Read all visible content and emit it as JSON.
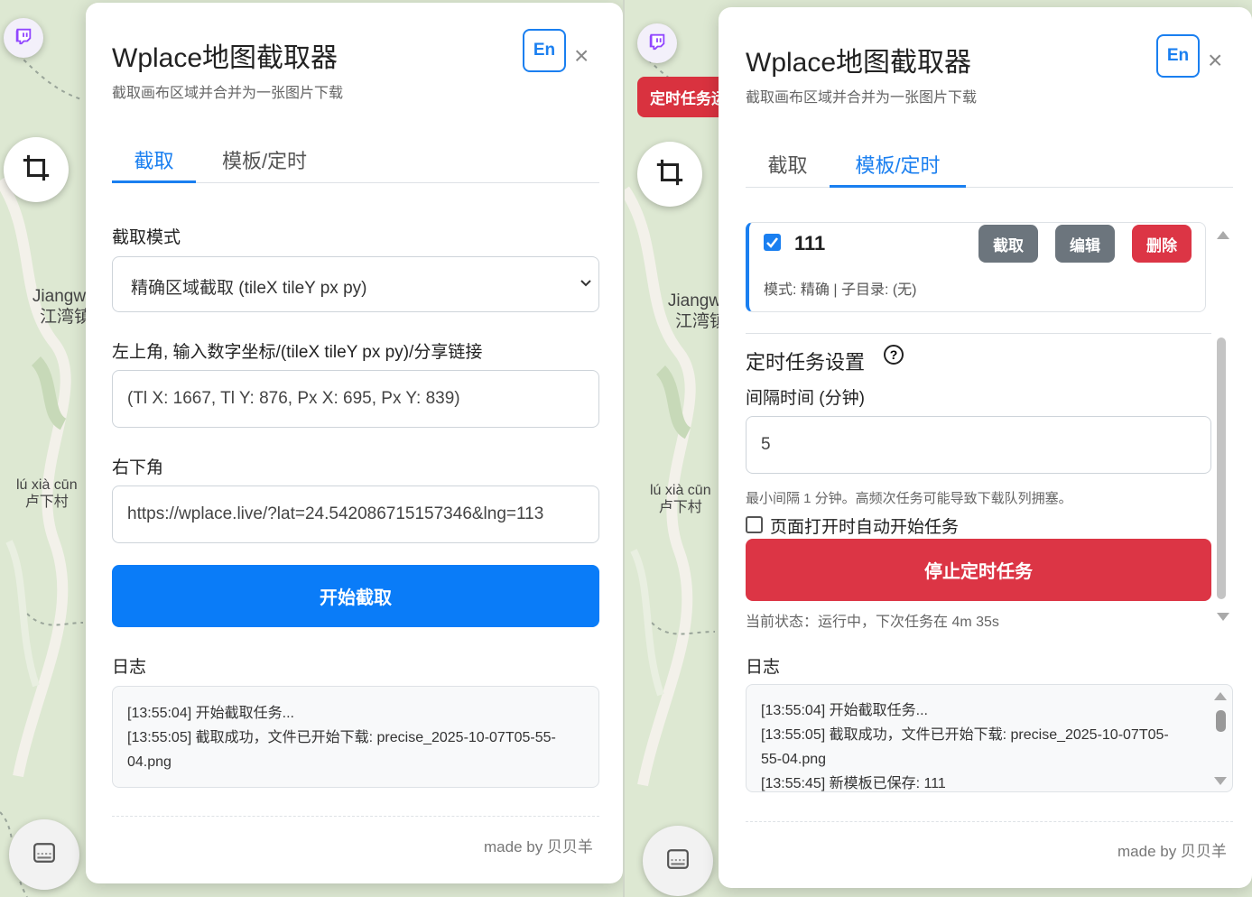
{
  "colors": {
    "accent": "#0a7cf8",
    "danger": "#dc3545",
    "secondary": "#6c757d"
  },
  "icons": {
    "twitch": "twitch-icon",
    "crop": "crop-icon",
    "gallery": "gallery-icon",
    "close": "close-icon",
    "chevron": "chevron-down-icon",
    "help": "help-circle-icon"
  },
  "map": {
    "label_jiangwan_latin": "Jiangw",
    "label_jiangwan_cn": "江湾镇",
    "label_luxia_latin": "lú xià cūn",
    "label_luxia_cn": "卢下村"
  },
  "left": {
    "panel_title": "Wplace地图截取器",
    "panel_subtitle": "截取画布区域并合并为一张图片下载",
    "lang_button": "En",
    "close": "×",
    "tabs": [
      "截取",
      "模板/定时"
    ],
    "mode_label": "截取模式",
    "mode_value": "精确区域截取 (tileX tileY px py)",
    "topleft_label": "左上角, 输入数字坐标/(tileX tileY px py)/分享链接",
    "topleft_value": "(Tl X: 1667, Tl Y: 876, Px X: 695, Px Y: 839)",
    "bottomright_label": "右下角",
    "bottomright_value": "https://wplace.live/?lat=24.542086715157346&lng=113",
    "start_button": "开始截取",
    "log_label": "日志",
    "log_lines": [
      "[13:55:04] 开始截取任务...",
      "[13:55:05] 截取成功，文件已开始下载: precise_2025-10-07T05-55-04.png"
    ],
    "made_by": "made by 贝贝羊"
  },
  "right": {
    "badge": "定时任务运行中",
    "panel_title": "Wplace地图截取器",
    "panel_subtitle": "截取画布区域并合并为一张图片下载",
    "lang_button": "En",
    "close": "×",
    "tabs": [
      "截取",
      "模板/定时"
    ],
    "template": {
      "name": "111",
      "checked": true,
      "btn_capture": "截取",
      "btn_edit": "编辑",
      "btn_delete": "删除",
      "meta": "模式: 精确 | 子目录: (无)"
    },
    "schedule_title": "定时任务设置",
    "interval_label": "间隔时间 (分钟)",
    "interval_value": "5",
    "interval_hint": "最小间隔 1 分钟。高频次任务可能导致下载队列拥塞。",
    "autostart_label": "页面打开时自动开始任务",
    "autostart_checked": false,
    "stop_button": "停止定时任务",
    "status_text": "当前状态：运行中，下次任务在 4m 35s",
    "log_label": "日志",
    "log_lines": [
      "[13:55:04] 开始截取任务...",
      "[13:55:05] 截取成功，文件已开始下载: precise_2025-10-07T05-55-04.png",
      "[13:55:45] 新模板已保存: 111"
    ],
    "made_by": "made by 贝贝羊"
  }
}
